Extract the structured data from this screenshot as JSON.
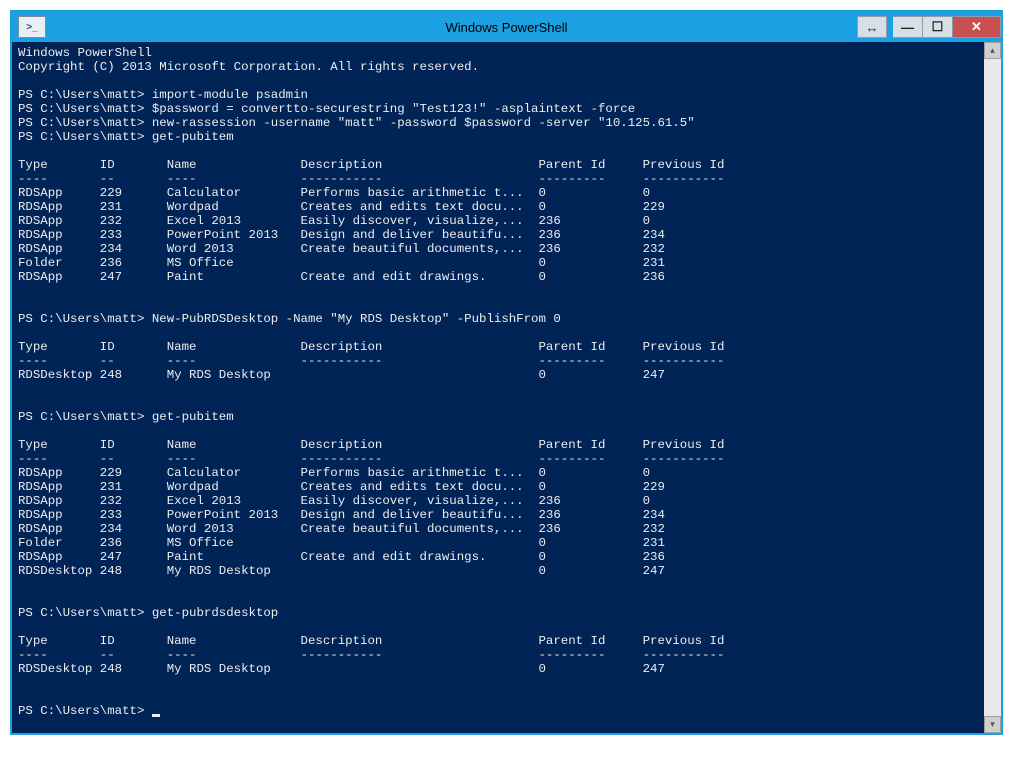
{
  "window": {
    "title": "Windows PowerShell",
    "icon_glyph": ">_"
  },
  "titlebar_buttons": {
    "resize": "↔",
    "minimize": "—",
    "maximize": "☐",
    "close": "✕"
  },
  "console": {
    "header": [
      "Windows PowerShell",
      "Copyright (C) 2013 Microsoft Corporation. All rights reserved."
    ],
    "prompt": "PS C:\\Users\\matt>",
    "commands": {
      "c1": "import-module psadmin",
      "c2": "$password = convertto-securestring \"Test123!\" -asplaintext -force",
      "c3": "new-rassession -username \"matt\" -password $password -server \"10.125.61.5\"",
      "c4": "get-pubitem",
      "c5": "New-PubRDSDesktop -Name \"My RDS Desktop\" -PublishFrom 0",
      "c6": "get-pubitem",
      "c7": "get-pubrdsdesktop"
    },
    "table_header": {
      "type": "Type",
      "id": "ID",
      "name": "Name",
      "description": "Description",
      "parent": "Parent Id",
      "previous": "Previous Id"
    },
    "table_divider": {
      "type": "----",
      "id": "--",
      "name": "----",
      "description": "-----------",
      "parent": "---------",
      "previous": "-----------"
    },
    "tables": {
      "t1": [
        {
          "type": "RDSApp",
          "id": "229",
          "name": "Calculator",
          "desc": "Performs basic arithmetic t...",
          "parent": "0",
          "prev": "0"
        },
        {
          "type": "RDSApp",
          "id": "231",
          "name": "Wordpad",
          "desc": "Creates and edits text docu...",
          "parent": "0",
          "prev": "229"
        },
        {
          "type": "RDSApp",
          "id": "232",
          "name": "Excel 2013",
          "desc": "Easily discover, visualize,...",
          "parent": "236",
          "prev": "0"
        },
        {
          "type": "RDSApp",
          "id": "233",
          "name": "PowerPoint 2013",
          "desc": "Design and deliver beautifu...",
          "parent": "236",
          "prev": "234"
        },
        {
          "type": "RDSApp",
          "id": "234",
          "name": "Word 2013",
          "desc": "Create beautiful documents,...",
          "parent": "236",
          "prev": "232"
        },
        {
          "type": "Folder",
          "id": "236",
          "name": "MS Office",
          "desc": "",
          "parent": "0",
          "prev": "231"
        },
        {
          "type": "RDSApp",
          "id": "247",
          "name": "Paint",
          "desc": "Create and edit drawings.",
          "parent": "0",
          "prev": "236"
        }
      ],
      "t2": [
        {
          "type": "RDSDesktop",
          "id": "248",
          "name": "My RDS Desktop",
          "desc": "",
          "parent": "0",
          "prev": "247"
        }
      ],
      "t3": [
        {
          "type": "RDSApp",
          "id": "229",
          "name": "Calculator",
          "desc": "Performs basic arithmetic t...",
          "parent": "0",
          "prev": "0"
        },
        {
          "type": "RDSApp",
          "id": "231",
          "name": "Wordpad",
          "desc": "Creates and edits text docu...",
          "parent": "0",
          "prev": "229"
        },
        {
          "type": "RDSApp",
          "id": "232",
          "name": "Excel 2013",
          "desc": "Easily discover, visualize,...",
          "parent": "236",
          "prev": "0"
        },
        {
          "type": "RDSApp",
          "id": "233",
          "name": "PowerPoint 2013",
          "desc": "Design and deliver beautifu...",
          "parent": "236",
          "prev": "234"
        },
        {
          "type": "RDSApp",
          "id": "234",
          "name": "Word 2013",
          "desc": "Create beautiful documents,...",
          "parent": "236",
          "prev": "232"
        },
        {
          "type": "Folder",
          "id": "236",
          "name": "MS Office",
          "desc": "",
          "parent": "0",
          "prev": "231"
        },
        {
          "type": "RDSApp",
          "id": "247",
          "name": "Paint",
          "desc": "Create and edit drawings.",
          "parent": "0",
          "prev": "236"
        },
        {
          "type": "RDSDesktop",
          "id": "248",
          "name": "My RDS Desktop",
          "desc": "",
          "parent": "0",
          "prev": "247"
        }
      ],
      "t4": [
        {
          "type": "RDSDesktop",
          "id": "248",
          "name": "My RDS Desktop",
          "desc": "",
          "parent": "0",
          "prev": "247"
        }
      ]
    }
  }
}
